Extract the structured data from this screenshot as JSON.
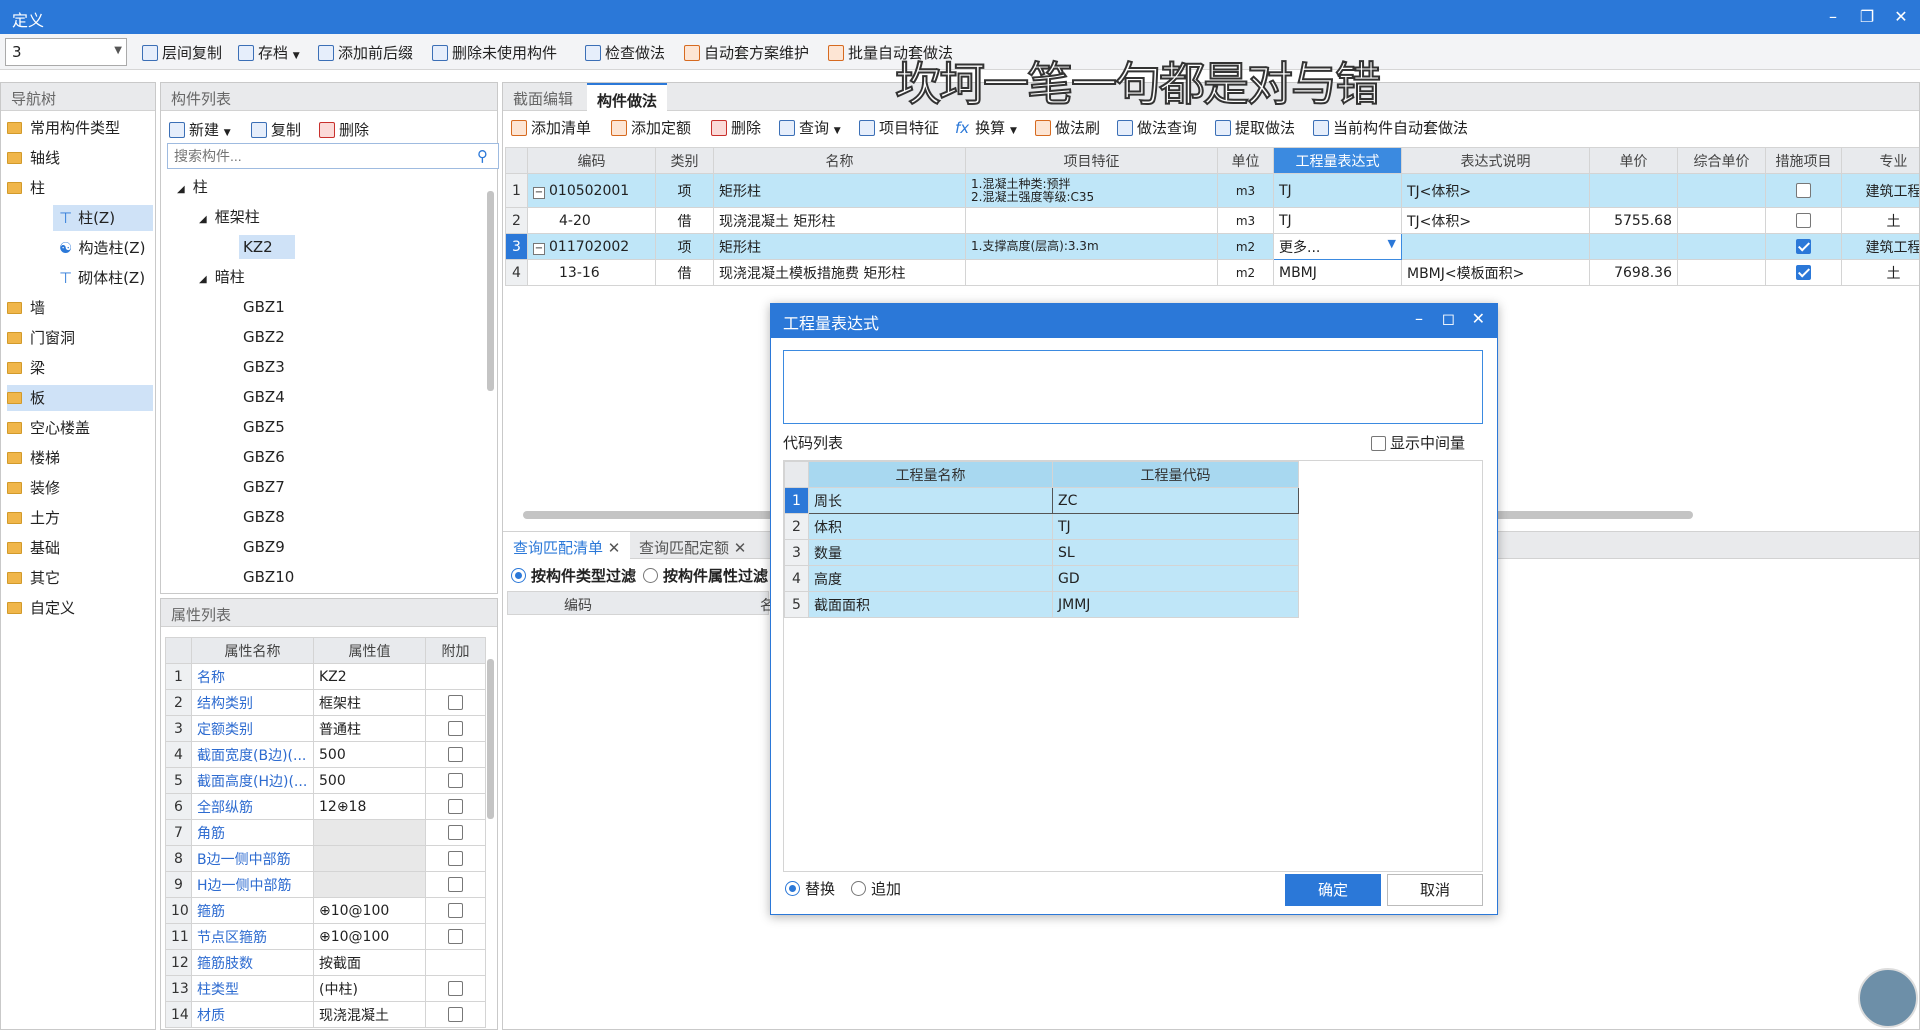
{
  "window": {
    "title": "定义"
  },
  "toolbar1": {
    "floor_value": "3",
    "items": [
      "层间复制",
      "存档",
      "添加前后缀",
      "删除未使用构件",
      "检查做法",
      "自动套方案维护",
      "批量自动套做法"
    ]
  },
  "overlay_text": "坎坷一笔一句都是对与错",
  "nav": {
    "title": "导航树",
    "items": [
      "常用构件类型",
      "轴线",
      "柱",
      "柱(Z)",
      "构造柱(Z)",
      "砌体柱(Z)",
      "墙",
      "门窗洞",
      "梁",
      "板",
      "空心楼盖",
      "楼梯",
      "装修",
      "土方",
      "基础",
      "其它",
      "自定义"
    ]
  },
  "component_list": {
    "title": "构件列表",
    "toolbar": [
      "新建",
      "复制",
      "删除"
    ],
    "search_placeholder": "搜索构件...",
    "tree": [
      "柱",
      "框架柱",
      "KZ2",
      "暗柱",
      "GBZ1",
      "GBZ2",
      "GBZ3",
      "GBZ4",
      "GBZ5",
      "GBZ6",
      "GBZ7",
      "GBZ8",
      "GBZ9",
      "GBZ10"
    ]
  },
  "property_list": {
    "title": "属性列表",
    "headers": [
      "属性名称",
      "属性值",
      "附加"
    ],
    "rows": [
      {
        "n": "1",
        "name": "名称",
        "value": "KZ2",
        "cb": false
      },
      {
        "n": "2",
        "name": "结构类别",
        "value": "框架柱",
        "cb": true
      },
      {
        "n": "3",
        "name": "定额类别",
        "value": "普通柱",
        "cb": true
      },
      {
        "n": "4",
        "name": "截面宽度(B边)(...",
        "value": "500",
        "cb": true
      },
      {
        "n": "5",
        "name": "截面高度(H边)(...",
        "value": "500",
        "cb": true
      },
      {
        "n": "6",
        "name": "全部纵筋",
        "value": "12⊕18",
        "cb": true
      },
      {
        "n": "7",
        "name": "角筋",
        "value": "",
        "cb": true
      },
      {
        "n": "8",
        "name": "B边一侧中部筋",
        "value": "",
        "cb": true
      },
      {
        "n": "9",
        "name": "H边一侧中部筋",
        "value": "",
        "cb": true
      },
      {
        "n": "10",
        "name": "箍筋",
        "value": "⊕10@100",
        "cb": true
      },
      {
        "n": "11",
        "name": "节点区箍筋",
        "value": "⊕10@100",
        "cb": true
      },
      {
        "n": "12",
        "name": "箍筋肢数",
        "value": "按截面",
        "cb": false
      },
      {
        "n": "13",
        "name": "柱类型",
        "value": "(中柱)",
        "cb": true
      },
      {
        "n": "14",
        "name": "材质",
        "value": "现浇混凝土",
        "cb": true
      }
    ]
  },
  "right_tabs": [
    "截面编辑",
    "构件做法"
  ],
  "right_toolbar": [
    "添加清单",
    "添加定额",
    "删除",
    "查询",
    "项目特征",
    "换算",
    "做法刷",
    "做法查询",
    "提取做法",
    "当前构件自动套做法"
  ],
  "method_table": {
    "headers": [
      "编码",
      "类别",
      "名称",
      "项目特征",
      "单位",
      "工程量表达式",
      "表达式说明",
      "单价",
      "综合单价",
      "措施项目",
      "专业"
    ],
    "rows": [
      {
        "n": "1",
        "code": "010502001",
        "type": "项",
        "name": "矩形柱",
        "feature1": "1.混凝土种类:预拌",
        "feature2": "2.混凝土强度等级:C35",
        "unit": "m3",
        "expr": "TJ",
        "desc": "TJ<体积>",
        "price": "",
        "cprice": "",
        "measure": false,
        "spec": "建筑工程"
      },
      {
        "n": "2",
        "code": "4-20",
        "type": "借",
        "name": "现浇混凝土 矩形柱",
        "feature1": "",
        "feature2": "",
        "unit": "m3",
        "expr": "TJ",
        "desc": "TJ<体积>",
        "price": "5755.68",
        "cprice": "",
        "measure": false,
        "spec": "土"
      },
      {
        "n": "3",
        "code": "011702002",
        "type": "项",
        "name": "矩形柱",
        "feature1": "1.支撑高度(层高):3.3m",
        "feature2": "",
        "unit": "m2",
        "expr": "更多...",
        "desc": "",
        "price": "",
        "cprice": "",
        "measure": true,
        "spec": "建筑工程"
      },
      {
        "n": "4",
        "code": "13-16",
        "type": "借",
        "name": "现浇混凝土模板措施费 矩形柱",
        "feature1": "",
        "feature2": "",
        "unit": "m2",
        "expr": "MBMJ",
        "desc": "MBMJ<模板面积>",
        "price": "7698.36",
        "cprice": "",
        "measure": true,
        "spec": "土"
      }
    ]
  },
  "bottom_tabs": [
    "查询匹配清单",
    "查询匹配定额"
  ],
  "bottom_filters": [
    "按构件类型过滤",
    "按构件属性过滤"
  ],
  "bottom_headers": [
    "编码",
    "名"
  ],
  "dialog": {
    "title": "工程量表达式",
    "code_list_label": "代码列表",
    "show_mid_label": "显示中间量",
    "headers": [
      "工程量名称",
      "工程量代码"
    ],
    "rows": [
      {
        "n": "1",
        "name": "周长",
        "code": "ZC"
      },
      {
        "n": "2",
        "name": "体积",
        "code": "TJ"
      },
      {
        "n": "3",
        "name": "数量",
        "code": "SL"
      },
      {
        "n": "4",
        "name": "高度",
        "code": "GD"
      },
      {
        "n": "5",
        "name": "截面面积",
        "code": "JMMJ"
      }
    ],
    "replace_label": "替换",
    "append_label": "追加",
    "ok_label": "确定",
    "cancel_label": "取消"
  },
  "colors": {
    "accent": "#2b78d8",
    "row_highlight": "#bfe6f8",
    "link": "#2d6bd0"
  }
}
